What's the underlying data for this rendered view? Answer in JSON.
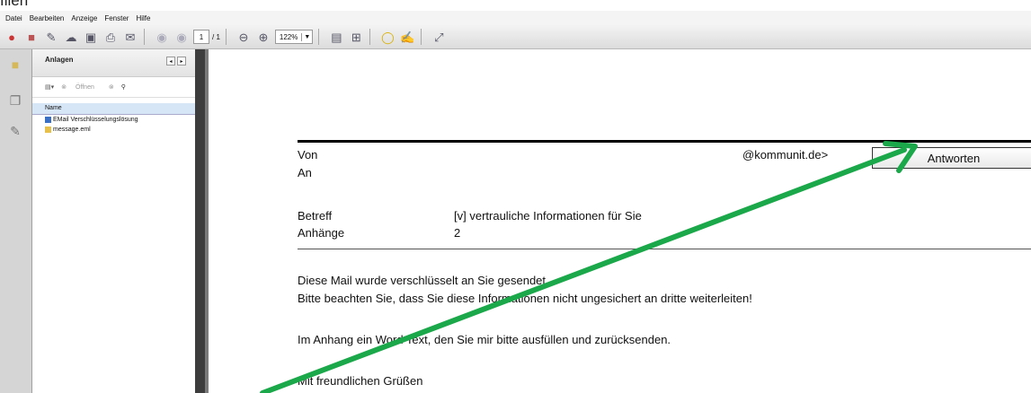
{
  "top_crop_text": "filen",
  "menu": [
    "Datei",
    "Bearbeiten",
    "Anzeige",
    "Fenster",
    "Hilfe"
  ],
  "toolbar": {
    "page_current": "1",
    "page_total": "/ 1",
    "zoom": "122%"
  },
  "panel": {
    "title": "Anlagen",
    "open_label": "Öffnen",
    "column_name": "Name",
    "files": [
      "EMail Verschlüsselungslösung",
      "message.eml"
    ]
  },
  "email": {
    "from_label": "Von",
    "from_value": "@kommunit.de>",
    "to_label": "An",
    "reply_button": "Antworten",
    "subject_label": "Betreff",
    "subject_value": "[v] vertrauliche Informationen für Sie",
    "attachments_label": "Anhänge",
    "attachments_value": "2",
    "body_line1": "Diese Mail wurde verschlüsselt an Sie gesendet.",
    "body_line2": "Bitte beachten Sie, dass Sie diese Informationen nicht ungesichert an dritte weiterleiten!",
    "body_line3": "Im Anhang ein Word Text, den Sie mir bitte ausfüllen und zurücksenden.",
    "body_line4": "Mit freundlichen Grüßen"
  },
  "colors": {
    "annotation_arrow": "#1aa84a",
    "splitter": "#3d3d3d",
    "column_header": "#d6e6f6"
  }
}
